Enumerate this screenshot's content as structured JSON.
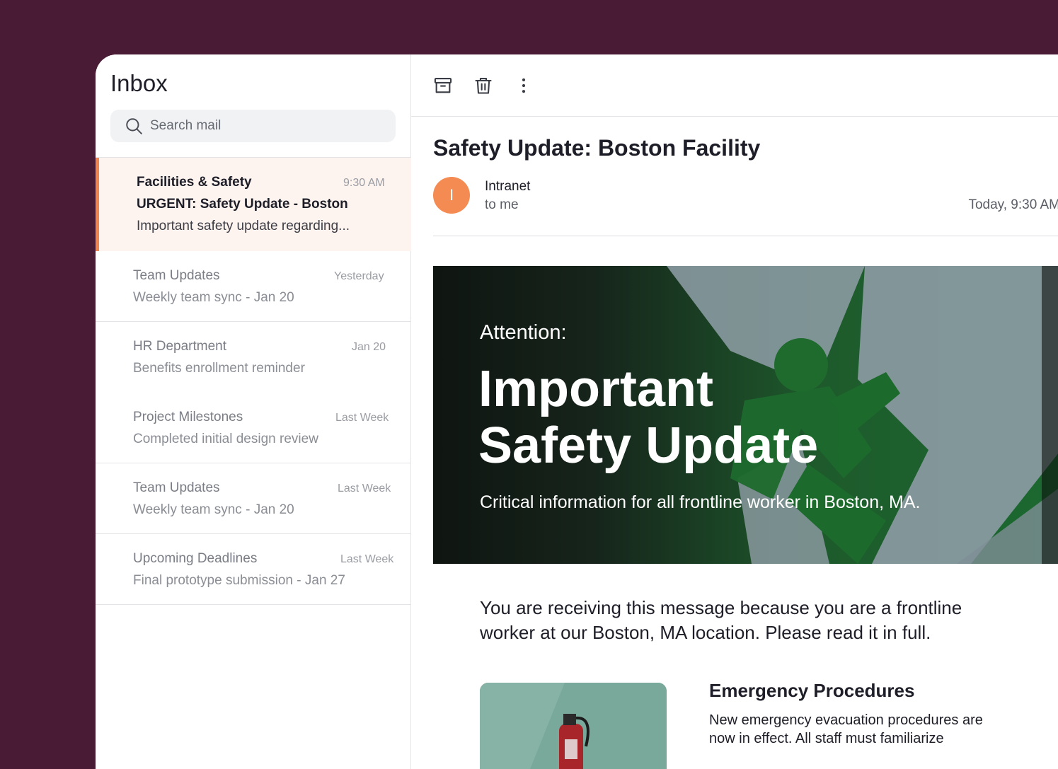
{
  "sidebar": {
    "title": "Inbox",
    "search": {
      "placeholder": "Search mail",
      "icon": "search-icon"
    },
    "mails": [
      {
        "sender": "Facilities & Safety",
        "time": "9:30 AM",
        "subject": "URGENT: Safety Update - Boston",
        "preview": "Important safety update regarding...",
        "selected": true
      },
      {
        "sender": "Team Updates",
        "time": "Yesterday",
        "subject": "Weekly team sync - Jan 20"
      },
      {
        "sender": "HR Department",
        "time": "Jan 20",
        "subject": "Benefits enrollment reminder"
      },
      {
        "sender": "Project Milestones",
        "time": "Last Week",
        "subject": "Completed initial design review"
      },
      {
        "sender": "Team Updates",
        "time": "Last Week",
        "subject": "Weekly team sync - Jan 20"
      },
      {
        "sender": "Upcoming Deadlines",
        "time": "Last Week",
        "subject": "Final prototype submission - Jan 27"
      }
    ]
  },
  "toolbar": {
    "icons": [
      "archive-icon",
      "trash-icon",
      "more-vertical-icon"
    ]
  },
  "email": {
    "title": "Safety Update: Boston Facility",
    "avatar_letter": "I",
    "avatar_color": "#f48b52",
    "from": "Intranet",
    "to": "to me",
    "received": "Today, 9:30 AM",
    "hero": {
      "kicker": "Attention:",
      "title_line1": "Important",
      "title_line2": "Safety Update",
      "subtitle": "Critical information for all frontline worker in Boston, MA."
    },
    "body": "You are receiving this message because you are a frontline worker at our Boston, MA location. Please read it in full.",
    "section": {
      "title": "Emergency Procedures",
      "text": "New emergency evacuation procedures are now in effect. All staff must familiarize"
    }
  },
  "colors": {
    "background": "#4a1b34",
    "accent": "#f0864f",
    "selected_bg": "#fef4ef"
  }
}
